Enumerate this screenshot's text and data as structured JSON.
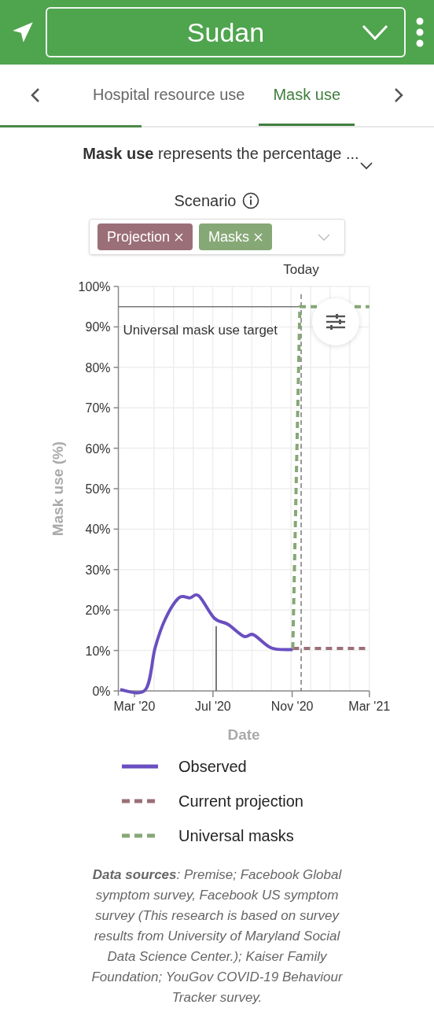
{
  "header": {
    "location": "Sudan"
  },
  "tabs": [
    {
      "label": "Hospital resource use",
      "selected": false
    },
    {
      "label": "Mask use",
      "selected": true
    }
  ],
  "description": {
    "text": "**Mask use** represents the percentage ...",
    "expanded": false
  },
  "scenario": {
    "label": "Scenario",
    "chips": [
      {
        "label": "Projection",
        "color": "#9b6f78"
      },
      {
        "label": "Masks",
        "color": "#86a876"
      }
    ]
  },
  "chart_data": {
    "type": "line",
    "xlabel": "Date",
    "ylabel": "Mask use (%)",
    "x": [
      "2020-02-08",
      "2020-03-18",
      "2020-04-02",
      "2020-04-18",
      "2020-05-09",
      "2020-05-26",
      "2020-06-09",
      "2020-07-03",
      "2020-07-24",
      "2020-08-18",
      "2020-09-02",
      "2020-09-30",
      "2020-11-02",
      "2020-11-13",
      "2021-03-01"
    ],
    "series": [
      {
        "name": "Observed",
        "color": "#6a4fc0",
        "line_style": "solid",
        "values": [
          0.3,
          0.3,
          10.6,
          17.8,
          23,
          23,
          23.5,
          18,
          16.5,
          13.5,
          13.9,
          10.6,
          10.2,
          null,
          null
        ]
      },
      {
        "name": "Current projection",
        "color": "#9b6f78",
        "line_style": "dashed",
        "values": [
          null,
          null,
          null,
          null,
          null,
          null,
          null,
          null,
          null,
          null,
          null,
          null,
          10.5,
          10.5,
          10.5
        ]
      },
      {
        "name": "Universal masks",
        "color": "#86a876",
        "line_style": "dashed",
        "values": [
          null,
          null,
          null,
          null,
          null,
          null,
          null,
          null,
          null,
          null,
          null,
          null,
          10.5,
          95,
          95
        ]
      }
    ],
    "xlim": [
      "2020-02-05",
      "2021-03-01"
    ],
    "ylim": [
      0,
      100
    ],
    "grid": true,
    "xticks": [
      {
        "value": "2020-03-01",
        "label": "Mar '20"
      },
      {
        "value": "2020-07-01",
        "label": "Jul '20"
      },
      {
        "value": "2020-11-01",
        "label": "Nov '20"
      },
      {
        "value": "2021-03-01",
        "label": "Mar '21"
      }
    ],
    "yticks": [
      {
        "value": 0,
        "label": "0%"
      },
      {
        "value": 10,
        "label": "10%"
      },
      {
        "value": 20,
        "label": "20%"
      },
      {
        "value": 30,
        "label": "30%"
      },
      {
        "value": 40,
        "label": "40%"
      },
      {
        "value": 50,
        "label": "50%"
      },
      {
        "value": 60,
        "label": "60%"
      },
      {
        "value": 70,
        "label": "70%"
      },
      {
        "value": 80,
        "label": "80%"
      },
      {
        "value": 90,
        "label": "90%"
      },
      {
        "value": 100,
        "label": "100%"
      }
    ],
    "ref_lines": [
      {
        "axis": "y",
        "value": 95,
        "label": "Universal mask use target"
      },
      {
        "axis": "x",
        "value": "2020-11-15",
        "label": "Today"
      },
      {
        "axis": "x",
        "value": "2020-07-06"
      }
    ]
  },
  "sources": "**Data sources**: Premise; Facebook Global symptom survey, Facebook US symptom survey (This research is based on survey results from University of Maryland Social Data Science Center.); Kaiser Family Foundation; YouGov COVID-19 Behaviour Tracker survey."
}
